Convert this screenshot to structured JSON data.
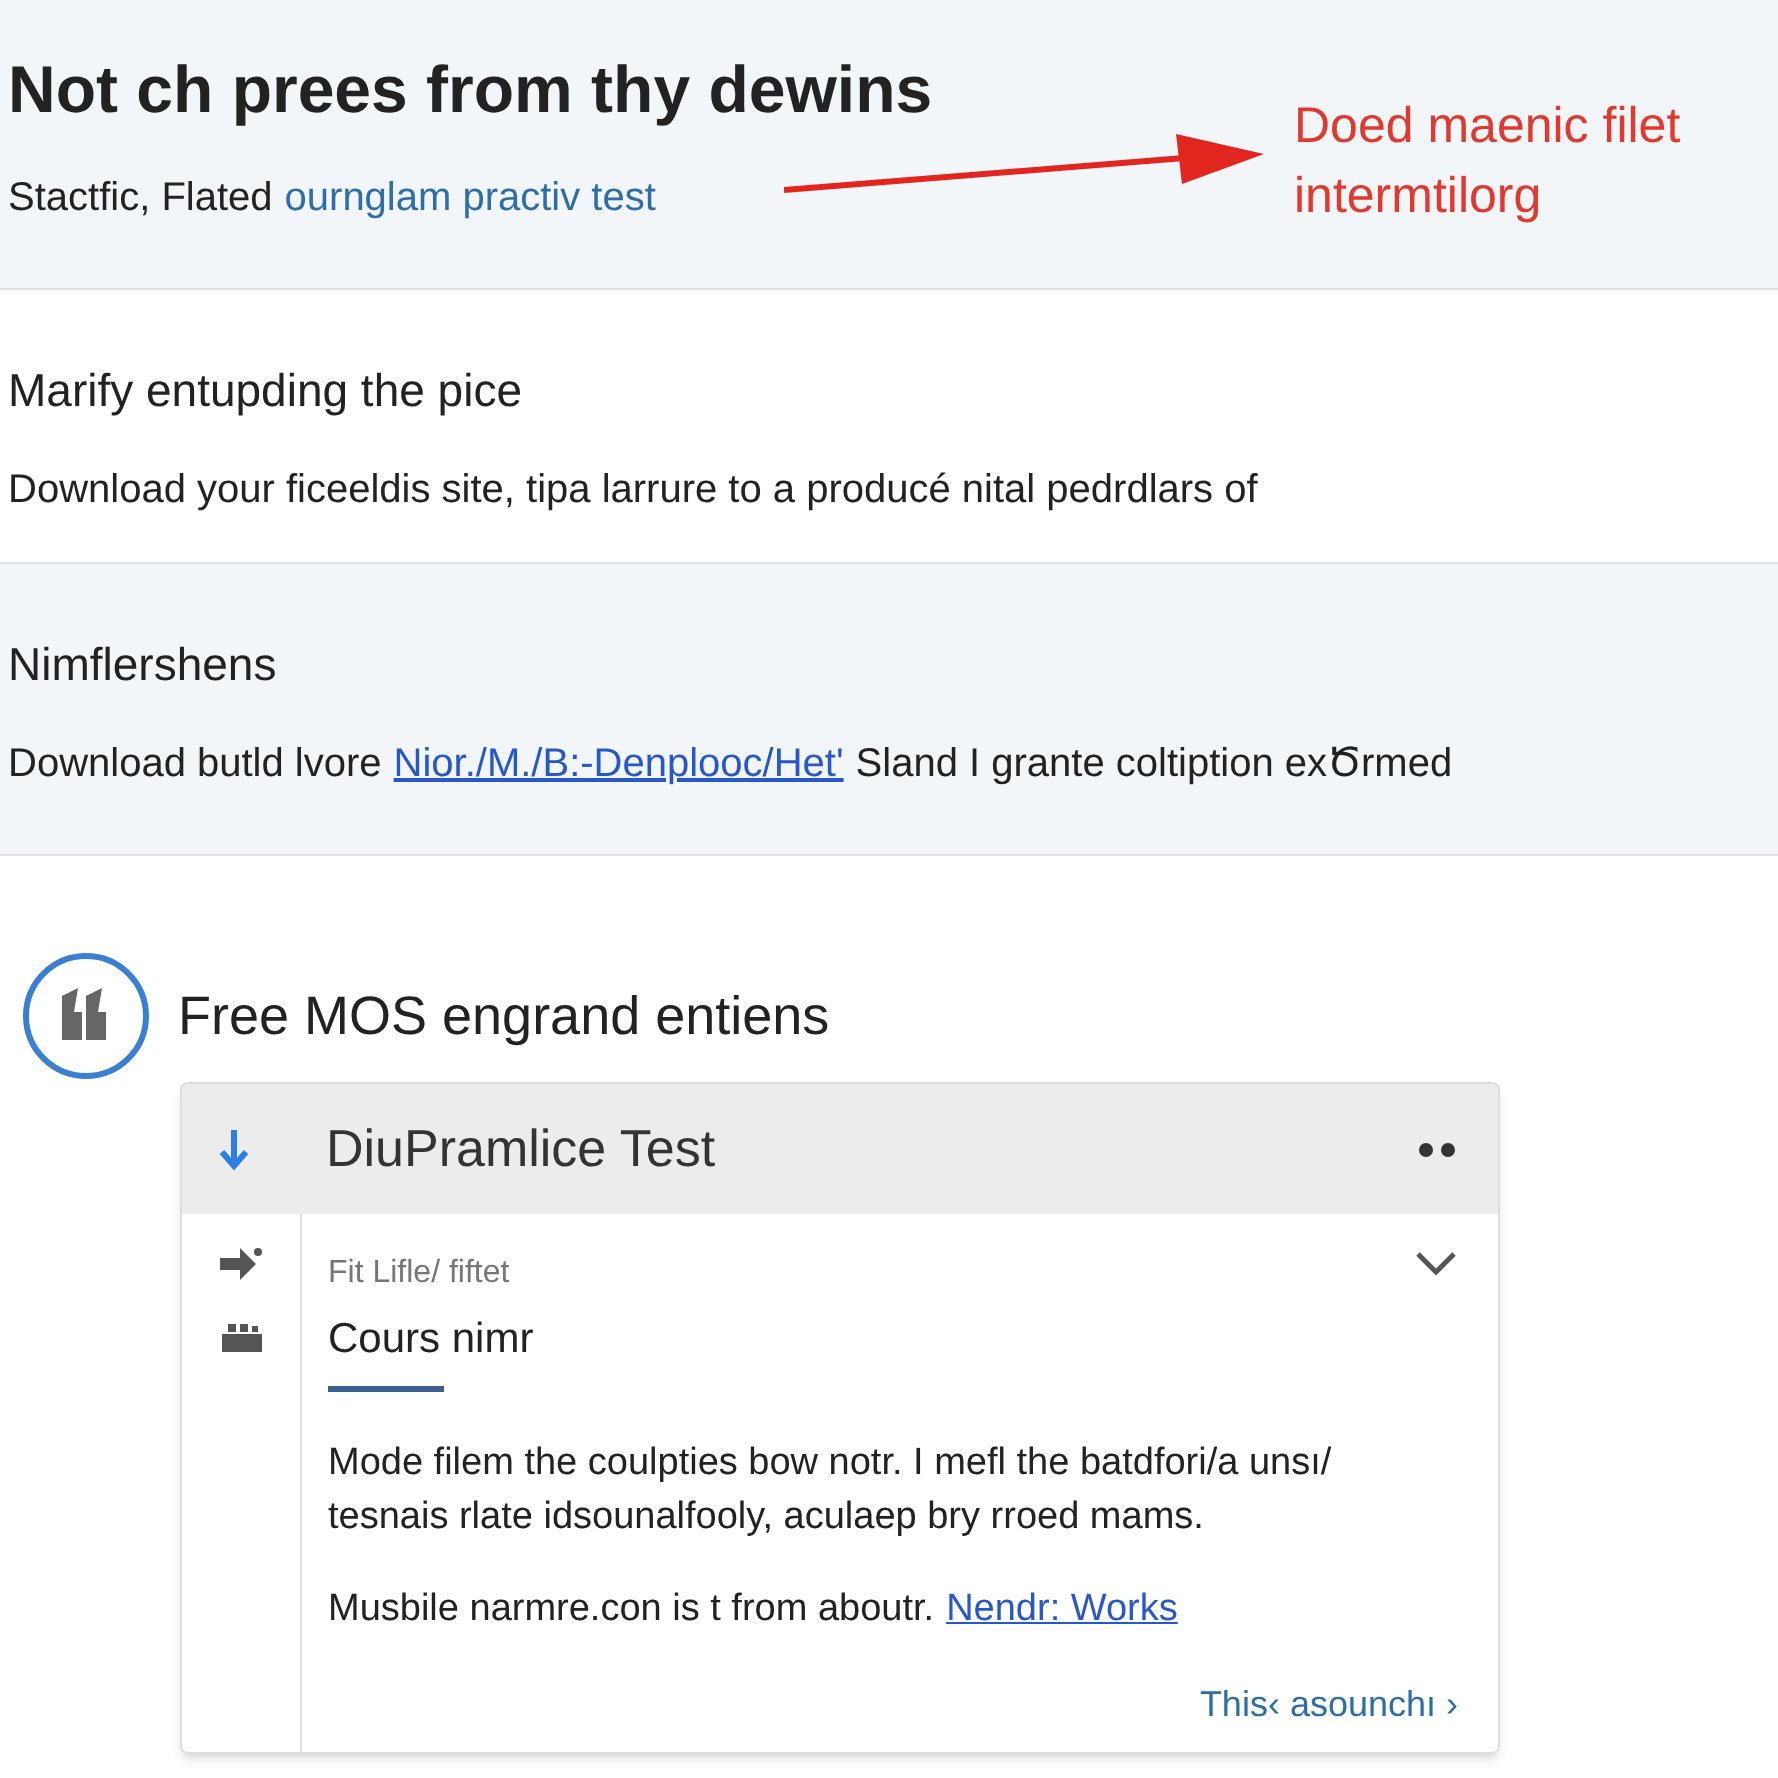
{
  "header": {
    "title": "Not ch prees from thy dewins",
    "subtitle": "Stactfic, Flated",
    "subtitle_link": "ournglam practiv test",
    "callout": "Doed maenic filet intermtilorg"
  },
  "sections": [
    {
      "heading": "Marify entupding the pice",
      "text": "Download your ficeeldis site, tipa larrure to a  producé nital pedrdlars of",
      "shaded": false
    },
    {
      "heading": "Nimflershens",
      "text_before": "Download butld lvore",
      "link": "Nior./M./B:-Denplooc/Het'",
      "text_after": "Sland I grante coltiption exԾrmed",
      "shaded": true
    }
  ],
  "feature": {
    "heading": "Free MOS engrand entiens",
    "card": {
      "title": "DiuPramlice Test",
      "label": "Fit Lifle/ fiftet",
      "subtitle": "Cours nimr",
      "expanded": false,
      "paragraph": "Mode filem the coulpties bow notr. I mefl the batdfori/a unsı/ tesnais rlate idsounalfooly, aculaep bry rroed mams.",
      "note": "Musbile narmre.con is t from aboutr.",
      "note_link": "Nendr: Works",
      "footer_link": "This‹ asounchı ›"
    }
  }
}
